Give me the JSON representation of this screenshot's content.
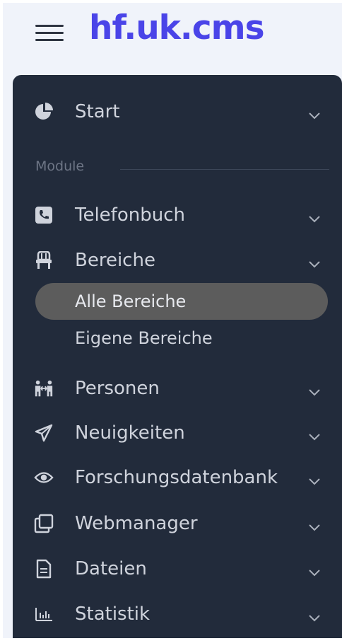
{
  "app": {
    "title": "hf.uk.cms"
  },
  "menu": {
    "top_items": [
      {
        "label": "Start",
        "icon": "pie-chart-icon"
      }
    ],
    "section_label": "Module",
    "items": [
      {
        "label": "Telefonbuch",
        "icon": "phone-icon"
      },
      {
        "label": "Bereiche",
        "icon": "chair-icon",
        "children": [
          {
            "label": "Alle Bereiche",
            "active": true
          },
          {
            "label": "Eigene Bereiche",
            "active": false
          }
        ]
      },
      {
        "label": "Personen",
        "icon": "people-icon"
      },
      {
        "label": "Neuigkeiten",
        "icon": "paper-plane-icon"
      },
      {
        "label": "Forschungsdatenbank",
        "icon": "eye-icon"
      },
      {
        "label": "Webmanager",
        "icon": "copy-icon"
      },
      {
        "label": "Dateien",
        "icon": "file-icon"
      },
      {
        "label": "Statistik",
        "icon": "bar-chart-icon"
      }
    ]
  },
  "colors": {
    "brand": "#4a44e8",
    "sidebar_bg": "#222b3b",
    "active_bg": "#5c5c5c",
    "page_bg": "#f0f3fa"
  }
}
